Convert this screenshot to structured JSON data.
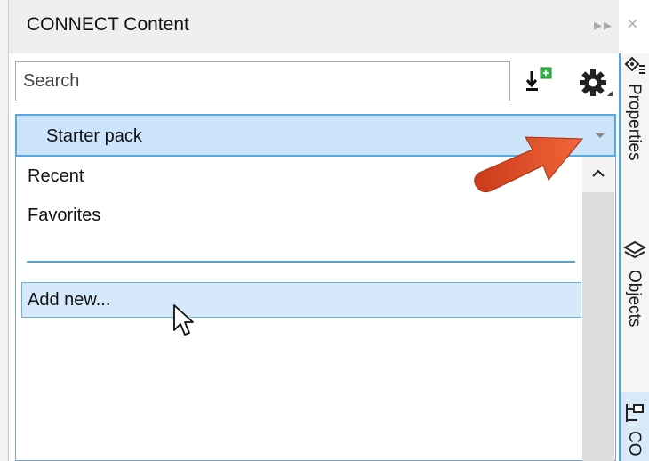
{
  "window": {
    "title": "CONNECT Content"
  },
  "search": {
    "placeholder": "Search",
    "value": ""
  },
  "pack_selector": {
    "selected": "Starter pack"
  },
  "dropdown": {
    "items": [
      {
        "label": "Recent"
      },
      {
        "label": "Favorites"
      }
    ],
    "add_new": "Add new..."
  },
  "dock": {
    "tabs": [
      {
        "label": "Properties",
        "icon": "properties-icon"
      },
      {
        "label": "Objects",
        "icon": "objects-icon"
      },
      {
        "label": "CO",
        "icon": "connect-icon"
      }
    ]
  },
  "colors": {
    "accent": "#59a8e6",
    "selection": "#cde5fb",
    "annotation_arrow": "#e8502a",
    "import_plus": "#2fb344"
  }
}
